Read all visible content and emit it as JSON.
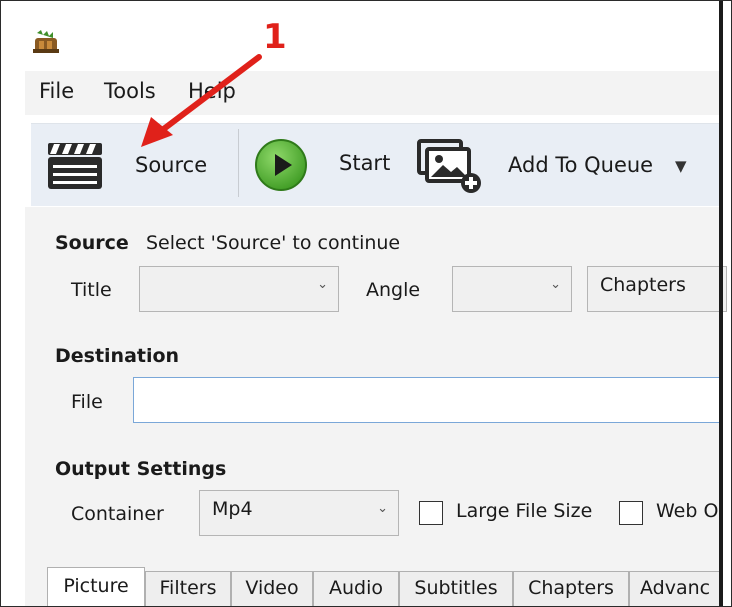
{
  "menu": {
    "file": "File",
    "tools": "Tools",
    "help": "Help"
  },
  "toolbar": {
    "source_label": "Source",
    "start_label": "Start",
    "add_to_queue_label": "Add To Queue"
  },
  "source_section": {
    "heading": "Source",
    "status": "Select 'Source' to continue",
    "title_label": "Title",
    "title_value": "",
    "angle_label": "Angle",
    "angle_value": "",
    "chapters_button": "Chapters"
  },
  "destination_section": {
    "heading": "Destination",
    "file_label": "File",
    "file_value": ""
  },
  "output_settings": {
    "heading": "Output Settings",
    "container_label": "Container",
    "container_value": "Mp4",
    "large_file_size_label": "Large File Size",
    "web_optimized_label": "Web O"
  },
  "tabs": [
    {
      "label": "Picture",
      "active": true
    },
    {
      "label": "Filters"
    },
    {
      "label": "Video"
    },
    {
      "label": "Audio"
    },
    {
      "label": "Subtitles"
    },
    {
      "label": "Chapters"
    },
    {
      "label": "Advanc"
    }
  ],
  "annotation": {
    "step_number": "1"
  },
  "colors": {
    "annotation": "#e0211a",
    "toolbar_bg": "#e9eef5",
    "panel_bg": "#f3f3f3",
    "start_green": "#4caa2e",
    "field_border": "#7aa7d8"
  },
  "icons": {
    "app": "handbrake-pineapple-icon",
    "source": "clapperboard-icon",
    "start": "play-icon",
    "queue": "add-image-queue-icon",
    "dropdown": "chevron-down-icon"
  }
}
